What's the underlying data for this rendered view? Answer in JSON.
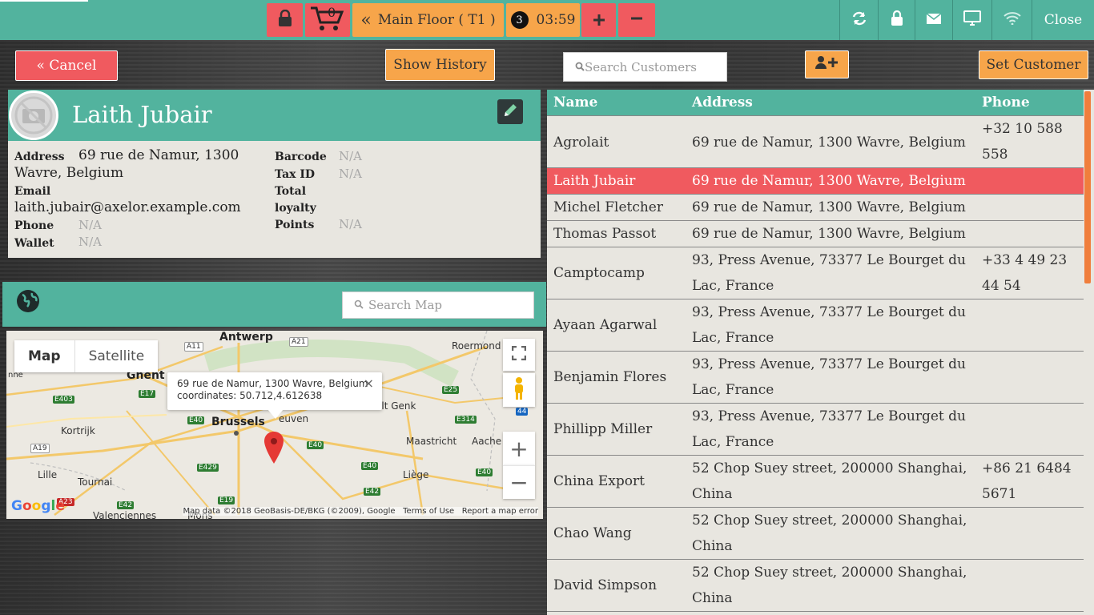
{
  "topbar": {
    "cart_count": "0",
    "floor_label": "Main Floor ( T1 )",
    "order_badge": "3",
    "timer": "03:59",
    "close_label": "Close"
  },
  "toolbar": {
    "cancel_label": "« Cancel",
    "show_history_label": "Show History",
    "search_placeholder": "Search Customers",
    "set_customer_label": "Set Customer"
  },
  "customer": {
    "name": "Laith Jubair",
    "address_label": "Address",
    "address_line1": "69 rue de Namur, 1300",
    "address_line2": "Wavre, Belgium",
    "email_label": "Email",
    "email": "laith.jubair@axelor.example.com",
    "phone_label": "Phone",
    "phone": "N/A",
    "wallet_label": "Wallet",
    "wallet": "N/A",
    "barcode_label": "Barcode",
    "barcode": "N/A",
    "taxid_label": "Tax ID",
    "taxid": "N/A",
    "total_label": "Total",
    "loyalty_label": "loyalty",
    "points_label": "Points",
    "points": "N/A"
  },
  "map": {
    "search_placeholder": "Search Map",
    "type_map": "Map",
    "type_satellite": "Satellite",
    "info_line1": "69 rue de Namur, 1300 Wavre, Belgium",
    "info_line2": "coordinates: 50.712,4.612638",
    "info_close": "×",
    "cities": {
      "antwerp": "Antwerp",
      "ghent": "Ghent",
      "brussels": "Brussels",
      "leuven": "euven",
      "roermond": "Roermond",
      "genk": "elt Genk",
      "maastricht": "Maastricht",
      "aachen": "Aache",
      "kortrijk": "Kortrijk",
      "lille": "Lille",
      "tournai": "Tournai",
      "liege": "Liège",
      "mons": "Mons",
      "valenciennes": "Valenciennes",
      "nne": "nne"
    },
    "highways": [
      "A11",
      "A21",
      "E17",
      "E403",
      "E40",
      "E40",
      "E40",
      "E314",
      "E25",
      "A19",
      "E429",
      "E40",
      "E42",
      "E19",
      "E42",
      "A23",
      "E40",
      "44",
      "E42"
    ],
    "google": "Google",
    "data_text": "Map data ©2018 GeoBasis-DE/BKG (©2009), Google",
    "terms": "Terms of Use",
    "report": "Report a map error",
    "plus": "+",
    "minus": "−"
  },
  "table": {
    "headers": {
      "name": "Name",
      "address": "Address",
      "phone": "Phone"
    },
    "rows": [
      {
        "name": "Agrolait",
        "address1": "69 rue de Namur, 1300 Wavre, Belgium",
        "address2": "",
        "phone1": "+32 10 588",
        "phone2": "558"
      },
      {
        "name": "Laith Jubair",
        "address1": "69 rue de Namur, 1300 Wavre, Belgium",
        "address2": "",
        "phone1": "",
        "phone2": ""
      },
      {
        "name": "Michel Fletcher",
        "address1": "69 rue de Namur, 1300 Wavre, Belgium",
        "address2": "",
        "phone1": "",
        "phone2": ""
      },
      {
        "name": "Thomas Passot",
        "address1": "69 rue de Namur, 1300 Wavre, Belgium",
        "address2": "",
        "phone1": "",
        "phone2": ""
      },
      {
        "name": "Camptocamp",
        "address1": "93, Press Avenue, 73377 Le Bourget du",
        "address2": "Lac, France",
        "phone1": "+33 4 49 23",
        "phone2": "44 54"
      },
      {
        "name": "Ayaan Agarwal",
        "address1": "93, Press Avenue, 73377 Le Bourget du",
        "address2": "Lac, France",
        "phone1": "",
        "phone2": ""
      },
      {
        "name": "Benjamin Flores",
        "address1": "93, Press Avenue, 73377 Le Bourget du",
        "address2": "Lac, France",
        "phone1": "",
        "phone2": ""
      },
      {
        "name": "Phillipp Miller",
        "address1": "93, Press Avenue, 73377 Le Bourget du",
        "address2": "Lac, France",
        "phone1": "",
        "phone2": ""
      },
      {
        "name": "China Export",
        "address1": "52 Chop Suey street, 200000 Shanghai,",
        "address2": "China",
        "phone1": "+86 21 6484",
        "phone2": "5671"
      },
      {
        "name": "Chao Wang",
        "address1": "52 Chop Suey street, 200000 Shanghai,",
        "address2": "China",
        "phone1": "",
        "phone2": ""
      },
      {
        "name": "David Simpson",
        "address1": "52 Chop Suey street, 200000 Shanghai,",
        "address2": "China",
        "phone1": "",
        "phone2": ""
      }
    ]
  },
  "colors": {
    "teal": "#52b39e",
    "red": "#f05a5f",
    "orange": "#f7a54a",
    "selected_row": "#f05a5f"
  }
}
